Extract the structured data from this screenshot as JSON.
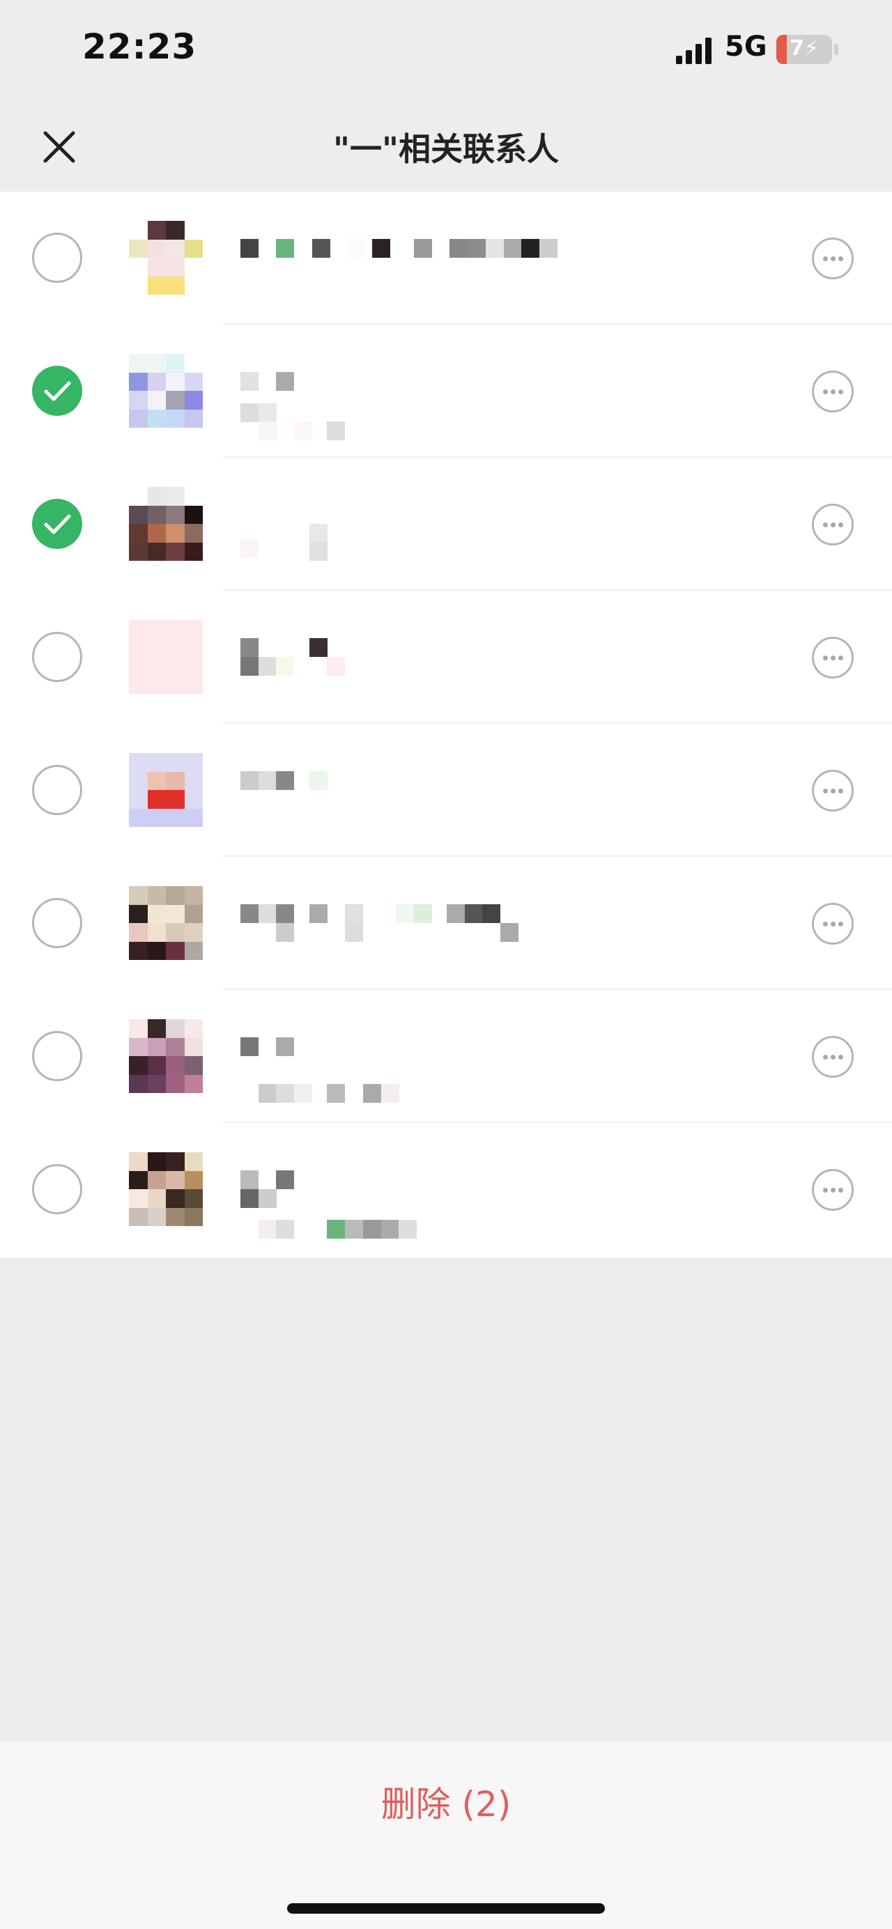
{
  "status_bar": {
    "time": "22:23",
    "network": "5G",
    "battery_text": "7",
    "battery_level_fraction": 0.07
  },
  "header": {
    "title": "\"一\"相关联系人",
    "close_icon": "close-icon"
  },
  "contacts": [
    {
      "checked": false,
      "avatar": [
        "#fff",
        "#5a3a3a",
        "#3a2828",
        "#fff",
        "#ede6c2",
        "#f4e0e0",
        "#f3e6e6",
        "#e8df8c",
        "#fff",
        "#f6e3e4",
        "#f6e3e4",
        "#fff",
        "#fff",
        "#f8e07a",
        "#f8e07a",
        "#fff"
      ]
    },
    {
      "checked": true,
      "avatar": [
        "#eef6f4",
        "#eef6f4",
        "#dff4f4",
        "#fff",
        "#8f96e0",
        "#d4d2ee",
        "#f1f2fb",
        "#d7d7f3",
        "#d6d6f3",
        "#f4f2f5",
        "#a5a4b3",
        "#8c8ae2",
        "#c6c6ef",
        "#c1dff0",
        "#c6d8f5",
        "#c6c6ef"
      ]
    },
    {
      "checked": true,
      "avatar": [
        "#fff",
        "#e9e6ea",
        "#eaeaea",
        "#fff",
        "#5a4a55",
        "#726068",
        "#8a7a80",
        "#1b1111",
        "#5e3a32",
        "#b0664a",
        "#d08e6a",
        "#8c6a5e",
        "#5a3a35",
        "#4a2a25",
        "#6a4040",
        "#3a1a1a"
      ]
    },
    {
      "checked": false,
      "avatar": [
        "#fde9ea",
        "#fde9ea",
        "#fde9ea",
        "#fde9ea",
        "#fde9ea",
        "#fde9ea",
        "#fde9ea",
        "#fde9ea",
        "#fde9ea",
        "#fde9ea",
        "#fde9ea",
        "#fde9ea",
        "#fde9ea",
        "#fde9ea",
        "#fde9ea",
        "#fde9ea"
      ]
    },
    {
      "checked": false,
      "avatar": [
        "#dcdcf5",
        "#dcdcf5",
        "#dcdcf5",
        "#dcdcf5",
        "#dcdcf5",
        "#f1c2b0",
        "#e8b8a8",
        "#dcdcf5",
        "#dcdcf5",
        "#e0302a",
        "#e0302a",
        "#dcdcf5",
        "#cdcdf5",
        "#cdcdf5",
        "#cdcdf5",
        "#cdcdf5"
      ]
    },
    {
      "checked": false,
      "avatar": [
        "#d5cbb8",
        "#c8baa8",
        "#b8a898",
        "#c4b4a4",
        "#2a2020",
        "#efe6d6",
        "#f0e8d8",
        "#b0a090",
        "#e8c8c0",
        "#f0e0d0",
        "#d8c8b8",
        "#e0d0c0",
        "#3a2020",
        "#2a1818",
        "#6a3040",
        "#b0a8a0"
      ]
    },
    {
      "checked": false,
      "avatar": [
        "#f8e8e8",
        "#3a2828",
        "#e0d8d8",
        "#f8e8e8",
        "#d8b8c8",
        "#c8a0b8",
        "#b08098",
        "#f0e0e0",
        "#3a2028",
        "#5a3048",
        "#9a6080",
        "#7a6070",
        "#5a3850",
        "#6a4060",
        "#a06080",
        "#c08098"
      ]
    },
    {
      "checked": false,
      "avatar": [
        "#f0d8c8",
        "#2a1818",
        "#3a2020",
        "#e8dcc0",
        "#2a1e18",
        "#c8a090",
        "#d8b8a8",
        "#b89060",
        "#f8e8e0",
        "#e8d8c8",
        "#3a2820",
        "#5a4838",
        "#c8c0b8",
        "#d8d0c8",
        "#a08870",
        "#8a7860"
      ]
    }
  ],
  "name_pixels": [
    [
      [
        "#444",
        0,
        0
      ],
      [
        "#6ab57e",
        1.2,
        0
      ],
      [
        "#555",
        2.4,
        0
      ],
      [
        "#fbfbfb",
        3.6,
        0
      ],
      [
        "#2a2228",
        4.4,
        0
      ],
      [
        "#999",
        5.8,
        0
      ],
      [
        "#888",
        7,
        0
      ],
      [
        "#8c8c8c",
        7.6,
        0
      ],
      [
        "#e4e4e4",
        8.2,
        0
      ],
      [
        "#aaa",
        8.8,
        0
      ],
      [
        "#222",
        9.4,
        0
      ],
      [
        "#ccc",
        10,
        0
      ]
    ],
    [
      [
        "#e2e2e2",
        0,
        0
      ],
      [
        "#aaa",
        1.2,
        0
      ],
      [
        "#ddd",
        0,
        1
      ],
      [
        "#e8e8e8",
        0.6,
        1
      ],
      [
        "#fbf4f5",
        0.6,
        1.6
      ],
      [
        "#fff5f5",
        1.8,
        1.6
      ],
      [
        "#ddd",
        2.9,
        1.6
      ]
    ],
    [
      [
        "#fbf4f6",
        0,
        1.1
      ],
      [
        "#e8e8e8",
        2.3,
        0.6
      ],
      [
        "#e0e0e0",
        2.3,
        1.2
      ]
    ],
    [
      [
        "#888",
        0,
        0
      ],
      [
        "#777",
        0,
        0.6
      ],
      [
        "#ddd",
        0.6,
        0.6
      ],
      [
        "#f8f8e8",
        1.2,
        0.6
      ],
      [
        "#3a2e36",
        2.3,
        0
      ],
      [
        "#fcecee",
        2.9,
        0.6
      ]
    ],
    [
      [
        "#ccc",
        0,
        0
      ],
      [
        "#ddd",
        0.6,
        0
      ],
      [
        "#888",
        1.2,
        0
      ],
      [
        "#eaf7ea",
        2.3,
        0
      ]
    ],
    [
      [
        "#888",
        0,
        0
      ],
      [
        "#ddd",
        0.6,
        0
      ],
      [
        "#888",
        1.2,
        0
      ],
      [
        "#aaa",
        2.3,
        0
      ],
      [
        "#e0e0e0",
        3.5,
        0
      ],
      [
        "#ccc",
        1.2,
        0.6
      ],
      [
        "#ddd",
        3.5,
        0.6
      ],
      [
        "#eef8ee",
        5.2,
        0
      ],
      [
        "#dcefdc",
        5.8,
        0
      ],
      [
        "#aaa",
        6.9,
        0
      ],
      [
        "#555",
        7.5,
        0
      ],
      [
        "#444",
        8.1,
        0
      ],
      [
        "#aaa",
        8.7,
        0.6
      ]
    ],
    [
      [
        "#777",
        0,
        0
      ],
      [
        "#aaa",
        1.2,
        0
      ],
      [
        "#f8f8f8",
        0.6,
        1.5
      ],
      [
        "#ccc",
        0.6,
        1.5
      ],
      [
        "#ddd",
        1.2,
        1.5
      ],
      [
        "#f0f0f0",
        1.8,
        1.5
      ],
      [
        "#bbb",
        2.9,
        1.5
      ],
      [
        "#aaa",
        4.1,
        1.5
      ],
      [
        "#f4eef0",
        4.7,
        1.5
      ]
    ],
    [
      [
        "#bbb",
        0,
        0
      ],
      [
        "#777",
        1.2,
        0
      ],
      [
        "#666",
        0,
        0.6
      ],
      [
        "#ccc",
        0.6,
        0.6
      ],
      [
        "#f4eef0",
        0.6,
        1.6
      ],
      [
        "#ddd",
        1.2,
        1.6
      ],
      [
        "#6ab57e",
        2.9,
        1.6
      ],
      [
        "#bbb",
        3.5,
        1.6
      ],
      [
        "#999",
        4.1,
        1.6
      ],
      [
        "#aaa",
        4.7,
        1.6
      ],
      [
        "#ddd",
        5.3,
        1.6
      ]
    ]
  ],
  "footer": {
    "delete_label": "删除 (2)"
  }
}
